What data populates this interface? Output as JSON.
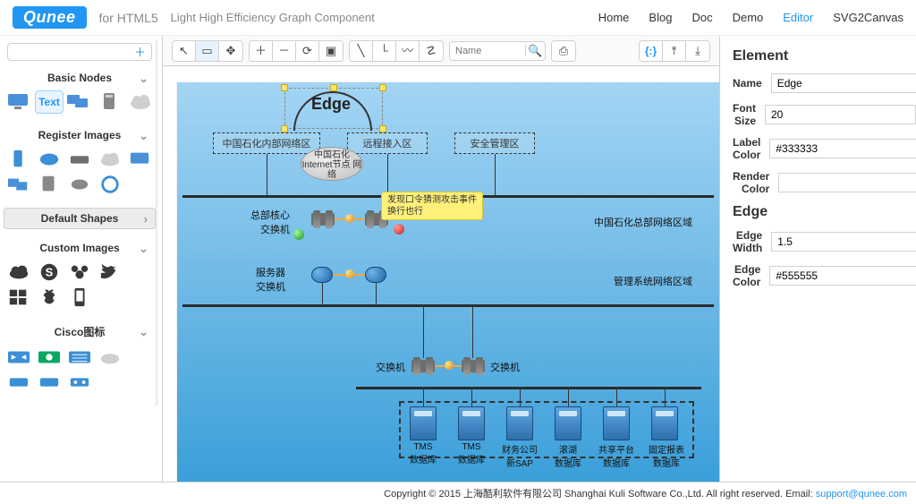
{
  "brand": {
    "name": "Qunee",
    "sub": "for HTML5",
    "tagline": "Light High Efficiency Graph Component"
  },
  "nav": {
    "items": [
      "Home",
      "Blog",
      "Doc",
      "Demo",
      "Editor",
      "SVG2Canvas"
    ],
    "active": "Editor"
  },
  "palette": {
    "sections": [
      {
        "title": "Basic Nodes",
        "textIcon": "Text"
      },
      {
        "title": "Register Images"
      },
      {
        "title": "Default Shapes"
      },
      {
        "title": "Custom Images"
      },
      {
        "title": "Cisco图标"
      }
    ]
  },
  "toolbar": {
    "search_placeholder": "Name",
    "json_label": "{:}"
  },
  "canvas": {
    "selection_label": "Edge",
    "boxes": {
      "net_internal": "中国石化内部网络区",
      "remote_access": "远程接入区",
      "security_mgmt": "安全管理区"
    },
    "ellipse": "中国石化\nInternet节点\n网络",
    "tooltip": "发现口令猜测攻击事件\n换行也行",
    "zone_hq": "中国石化总部网络区域",
    "zone_mgmt": "管理系统网络区域",
    "hq_switch": "总部核心\n交换机",
    "srv_switch": "服务器\n交换机",
    "switch_label": "交换机",
    "servers": [
      "TMS\n数据库",
      "TMS\n数据库",
      "财务公司\n新SAP",
      "滚湖\n数据库",
      "共享平台\n数据库",
      "固定报表\n数据库"
    ]
  },
  "props": {
    "element_title": "Element",
    "name_label": "Name",
    "name_value": "Edge",
    "fontsize_label": "Font Size",
    "fontsize_value": "20",
    "labelcolor_label": "Label Color",
    "labelcolor_value": "#333333",
    "rendercolor_label": "Render Color",
    "edge_title": "Edge",
    "edgewidth_label": "Edge Width",
    "edgewidth_value": "1.5",
    "edgecolor_label": "Edge Color",
    "edgecolor_value": "#555555"
  },
  "footer": {
    "copyright": "Copyright © 2015 上海酷利软件有限公司 Shanghai Kuli Software Co.,Ltd. All right reserved. Email: ",
    "email": "support@qunee.com"
  }
}
